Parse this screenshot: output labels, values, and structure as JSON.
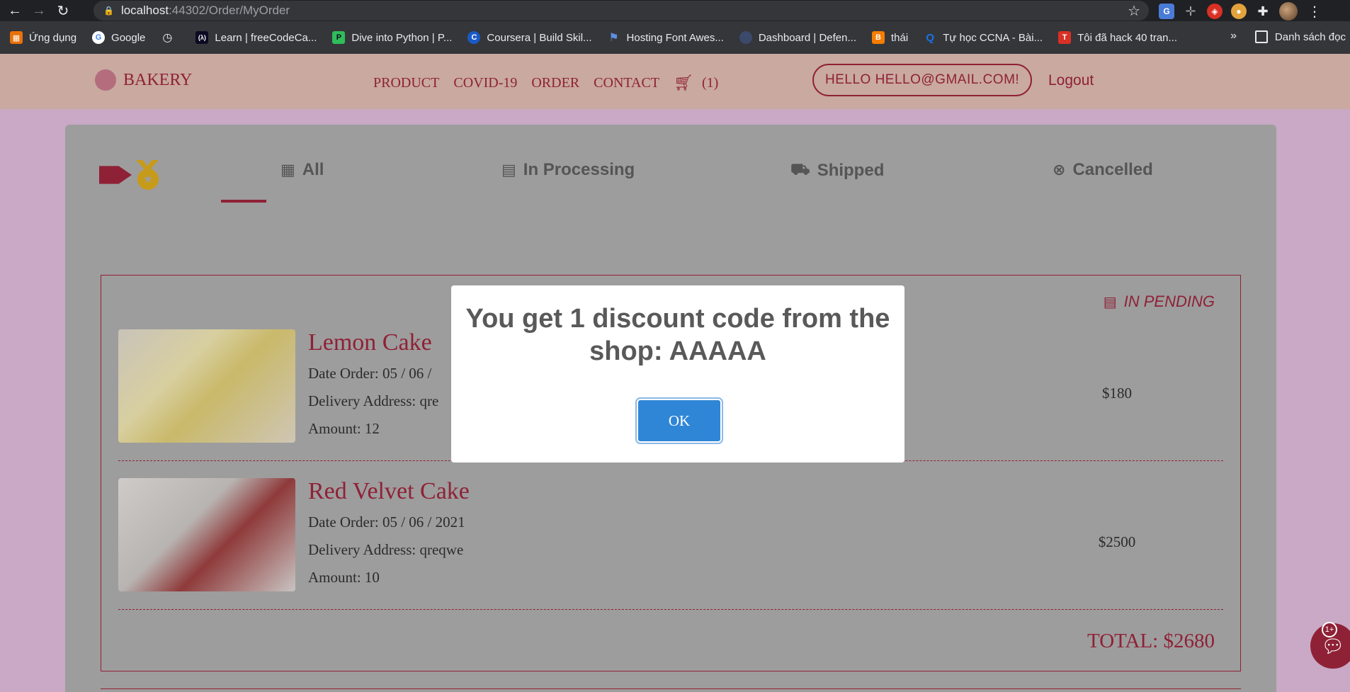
{
  "browser": {
    "url_host": "localhost",
    "url_path": ":44302/Order/MyOrder",
    "bookmarks": [
      {
        "label": "Ứng dụng",
        "icon": "apps-grid-icon",
        "color": "#e8710a"
      },
      {
        "label": "Google",
        "icon": "google-icon",
        "color": "#4285f4"
      },
      {
        "label": "",
        "icon": "history-icon",
        "color": "#9aa0a6"
      },
      {
        "label": "Learn | freeCodeCa...",
        "icon": "freecodecamp-icon",
        "color": "#0a0a23"
      },
      {
        "label": "Dive into Python | P...",
        "icon": "python-icon",
        "color": "#2fbd5a"
      },
      {
        "label": "Coursera | Build Skil...",
        "icon": "coursera-icon",
        "color": "#1a5ac6"
      },
      {
        "label": "Hosting Font Awes...",
        "icon": "flag-icon",
        "color": "#5c8fe0"
      },
      {
        "label": "Dashboard | Defen...",
        "icon": "globe-icon",
        "color": "#3b4a6b"
      },
      {
        "label": "thái",
        "icon": "blogger-icon",
        "color": "#f57d00"
      },
      {
        "label": "Tự học CCNA - Bài...",
        "icon": "search-q-icon",
        "color": "#1a73e8"
      },
      {
        "label": "Tôi đã hack 40 tran...",
        "icon": "t-icon",
        "color": "#d93025"
      }
    ],
    "more": "»",
    "reading_list": "Danh sách đọc"
  },
  "site": {
    "brand": "BAKERY",
    "nav": [
      "PRODUCT",
      "COVID-19",
      "ORDER",
      "CONTACT"
    ],
    "cart_count": "(1)",
    "greeting": "HELLO HELLO@GMAIL.COM!",
    "logout": "Logout"
  },
  "tabs": [
    {
      "label": "All",
      "icon": "grid-icon"
    },
    {
      "label": "In Processing",
      "icon": "box-open-icon"
    },
    {
      "label": "Shipped",
      "icon": "truck-icon"
    },
    {
      "label": "Cancelled",
      "icon": "times-circle-icon"
    }
  ],
  "order": {
    "status": "IN PENDING",
    "items": [
      {
        "name": "Lemon Cake",
        "date": "Date Order: 05 / 06 /",
        "address": "Delivery Address: qre",
        "amount": "Amount: 12",
        "price": "$180"
      },
      {
        "name": "Red Velvet Cake",
        "date": "Date Order: 05 / 06 / 2021",
        "address": "Delivery Address: qreqwe",
        "amount": "Amount: 10",
        "price": "$2500"
      }
    ],
    "total": "TOTAL: $2680"
  },
  "chat": {
    "badge": "1+"
  },
  "modal": {
    "message": "You get 1 discount code from the shop: AAAAA",
    "ok_label": "OK"
  }
}
